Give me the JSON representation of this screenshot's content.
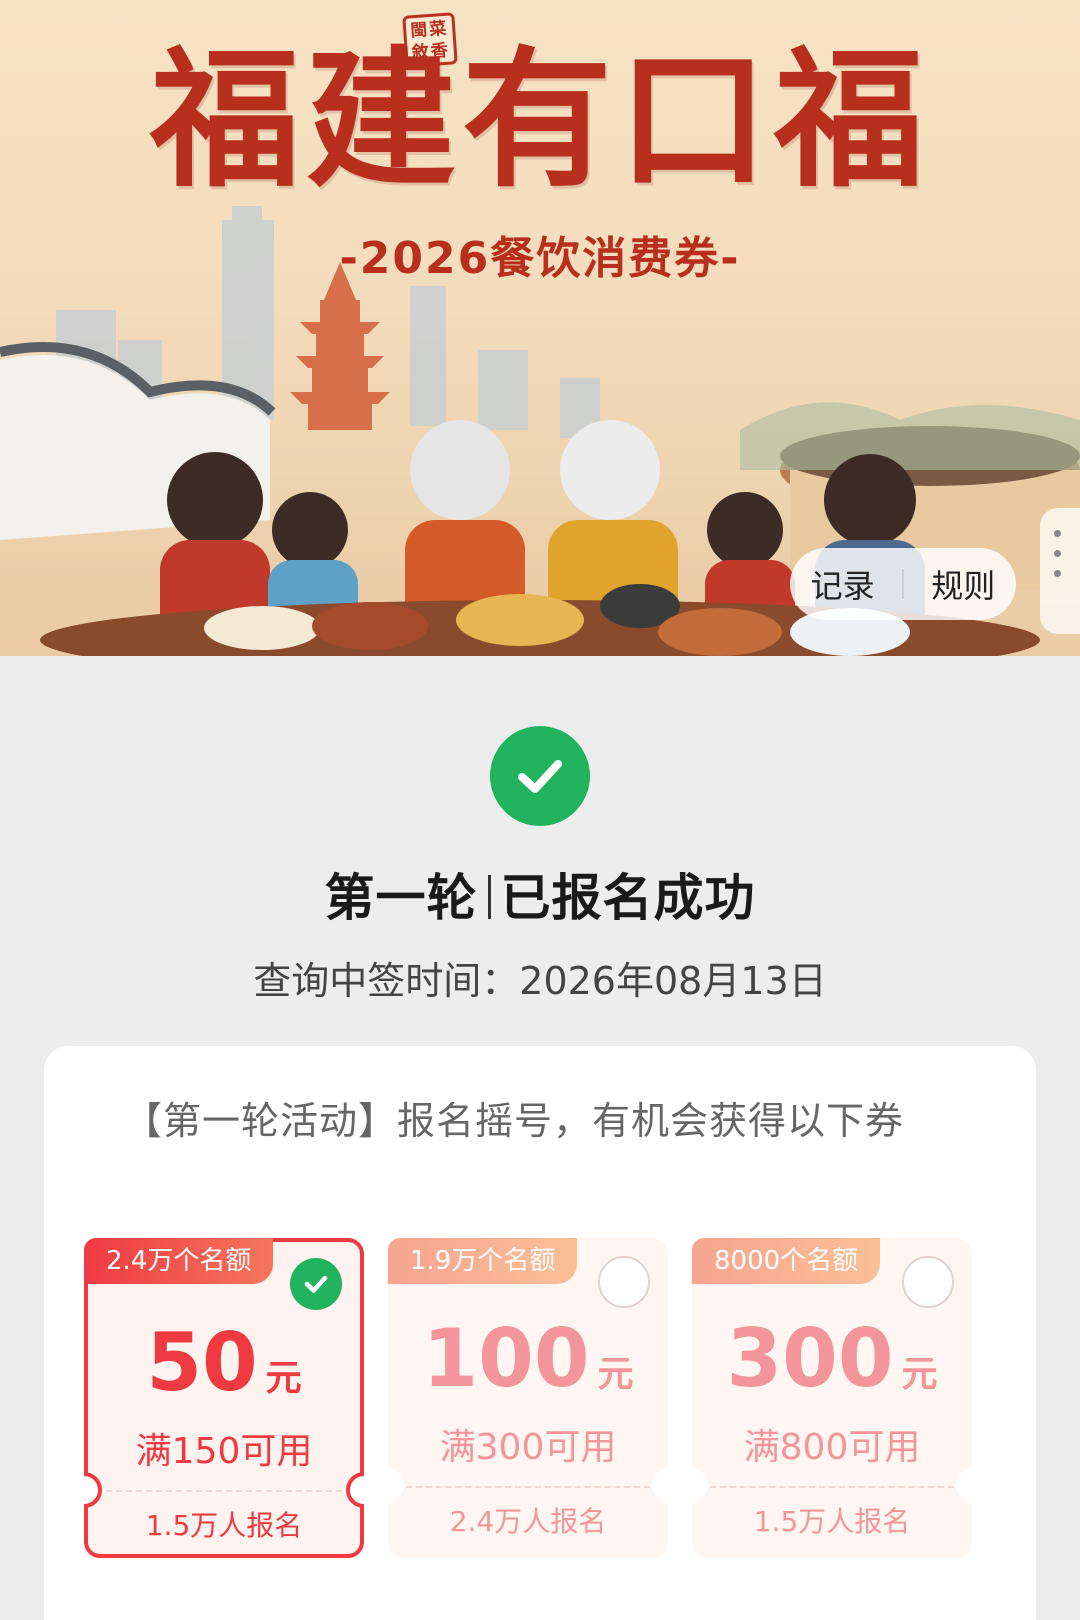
{
  "banner": {
    "seal_text": "閩菜敘香",
    "title": "福建有口福",
    "subtitle": "-2026餐饮消费券-",
    "actions": {
      "record_label": "记录",
      "rules_label": "规则"
    }
  },
  "status": {
    "title_round": "第一轮",
    "title_state": "已报名成功",
    "query_time": "查询中签时间：2026年08月13日",
    "accent": "#22b35e"
  },
  "activity": {
    "intro": "【第一轮活动】报名摇号，有机会获得以下券",
    "coupons": [
      {
        "quota": "2.4万个名额",
        "amount": "50",
        "unit": "元",
        "condition": "满150可用",
        "signups": "1.5万人报名",
        "selected": true
      },
      {
        "quota": "1.9万个名额",
        "amount": "100",
        "unit": "元",
        "condition": "满300可用",
        "signups": "2.4万人报名",
        "selected": false
      },
      {
        "quota": "8000个名额",
        "amount": "300",
        "unit": "元",
        "condition": "满800可用",
        "signups": "1.5万人报名",
        "selected": false
      }
    ]
  },
  "colors": {
    "primary_red": "#ef3a42",
    "brand_red": "#b92f1e",
    "success_green": "#22b35e"
  }
}
